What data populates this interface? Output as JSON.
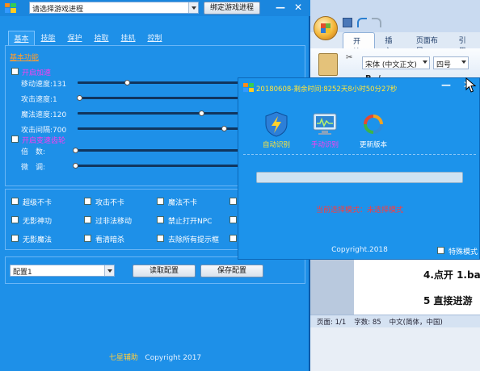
{
  "main": {
    "game_process_combo": "请选择游戏进程",
    "bind_button": "绑定游戏进程",
    "minimize": "—",
    "close": "✕",
    "tabs": [
      "基本",
      "技能",
      "保护",
      "拾取",
      "挂机",
      "控制"
    ],
    "section_title": "基本功能",
    "enable_speed": "开启加速",
    "sliders": [
      {
        "label": "移动速度:131",
        "value": 0.31
      },
      {
        "label": "攻击速度:1",
        "value": 0.0
      },
      {
        "label": "魔法速度:120",
        "value": 0.78
      },
      {
        "label": "攻击间隔:700",
        "value": 0.87
      }
    ],
    "enable_gear": "开启变速齿轮",
    "gear_sliders": [
      {
        "label": "倍　数:",
        "value": 0.0
      },
      {
        "label": "微　调:",
        "value": 0.0
      }
    ],
    "options": [
      [
        "超级不卡",
        "攻击不卡",
        "魔法不卡"
      ],
      [
        "无影神功",
        "过非法移动",
        "禁止打开NPC"
      ],
      [
        "无影魔法",
        "看清暗杀",
        "去除所有提示框"
      ]
    ],
    "config_combo": "配置1",
    "load_button": "读取配置",
    "save_button": "保存配置",
    "footer_brand": "七星辅助",
    "footer_copy": "Copyright 2017"
  },
  "popup": {
    "title": "20180608-剩余时间:8252天8小时50分27秒",
    "minimize": "—",
    "close": "✕",
    "features": [
      "自动识别",
      "手动识别",
      "更新版本"
    ],
    "progress": 0.0,
    "mode_text": "当前选择模式：未选择模式",
    "copyright": "Copyright.2018",
    "special_mode": "特殊模式"
  },
  "word": {
    "tabs": [
      "开始",
      "插入",
      "页面布局",
      "引用"
    ],
    "font": "宋体 (中文正文)",
    "size": "四号",
    "doc_lines": [
      "4.点开 1.ba",
      "5 直接进游"
    ],
    "status": [
      "页面: 1/1",
      "字数: 85",
      "中文(简体，中国)"
    ]
  },
  "colors": {
    "main_bg": "#1e90e8",
    "popup_bg": "#1c93eb",
    "section_title": "#ff9d2e",
    "magenta_label": "#ff3df0",
    "mode_red": "#ff3b3b",
    "title_yellow": "#ffe53a"
  }
}
